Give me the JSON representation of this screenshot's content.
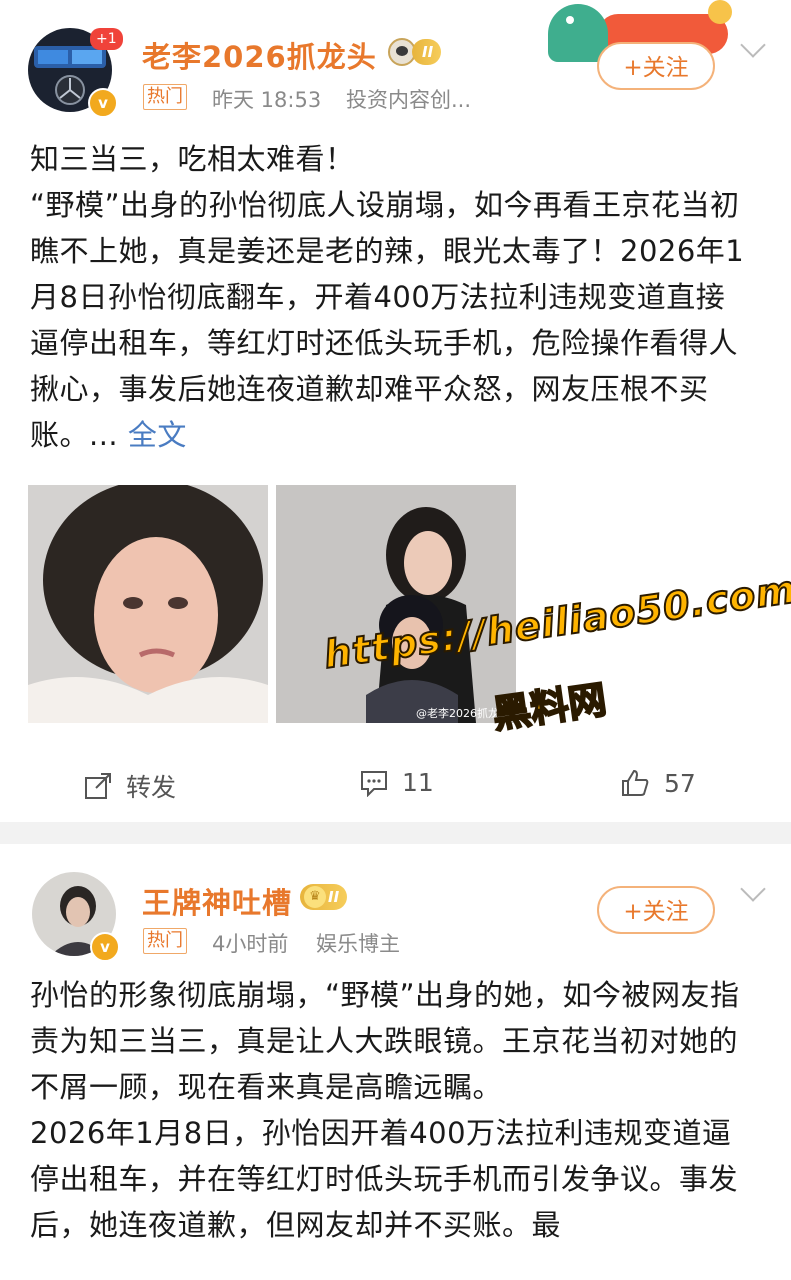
{
  "posts": [
    {
      "username": "老李2026抓龙头",
      "level": "II",
      "notif_badge": "+1",
      "tag": "热门",
      "time": "昨天 18:53",
      "source": "投资内容创...",
      "follow_label": "+关注",
      "body": [
        "知三当三，吃相太难看！",
        "“野模”出身的孙怡彻底人设崩塌，如今再看王京花当初瞧不上她，真是姜还是老的辣，眼光太毒了！2026年1月8日孙怡彻底翻车，开着400万法拉利违规变道直接逼停出租车，等红灯时还低头玩手机，危险操作看得人揪心，事发后她连夜道歉却难平众怒，网友压根不买账。... "
      ],
      "more_label": "全文",
      "image_caption": "@老李2026抓龙头",
      "repost_label": "转发",
      "comment_count": "11",
      "like_count": "57"
    },
    {
      "username": "王牌神吐槽",
      "level": "II",
      "tag": "热门",
      "time": "4小时前",
      "source": "娱乐博主",
      "follow_label": "+关注",
      "body": [
        "孙怡的形象彻底崩塌，“野模”出身的她，如今被网友指责为知三当三，真是让人大跌眼镜。王京花当初对她的不屑一顾，现在看来真是高瞻远瞩。",
        "2026年1月8日，孙怡因开着400万法拉利违规变道逼停出租车，并在等红灯时低头玩手机而引发争议。事发后，她连夜道歉，但网友却并不买账。最"
      ]
    }
  ],
  "watermark": {
    "url": "https://heiliao50.com",
    "name": "黑料网"
  }
}
